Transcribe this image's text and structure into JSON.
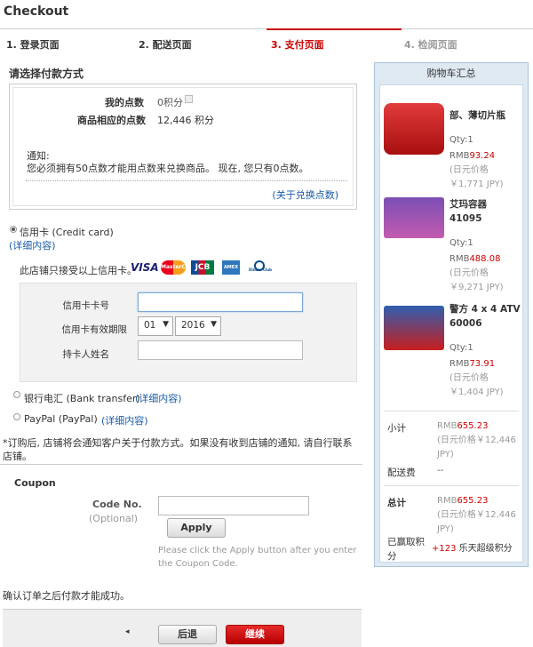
{
  "page": {
    "title": "Checkout"
  },
  "steps": [
    {
      "label": "1. 登录页面"
    },
    {
      "label": "2. 配送页面"
    },
    {
      "label": "3. 支付页面"
    },
    {
      "label": "4. 检阅页面"
    }
  ],
  "payment": {
    "section_title": "请选择付款方式",
    "points": {
      "my_points_label": "我的点数",
      "my_points_value": "0积分",
      "product_points_label": "商品相应的点数",
      "product_points_value": "12,446 积分",
      "notice_title": "通知:",
      "notice_text": "您必须拥有50点数才能用点数来兑换商品。 现在, 您只有0点数。",
      "about_link": "(关于兑换点数)"
    },
    "credit_card": {
      "label": "信用卡 (Credit card)",
      "details_link": "(详细内容)",
      "accepted_text": "此店铺只接受以上信用卡。",
      "logos": [
        "VISA",
        "MasterCard",
        "JCB",
        "AMEX",
        "Diners Club"
      ],
      "number_label": "信用卡卡号",
      "number_value": "",
      "expiry_label": "信用卡有效期限",
      "expiry_month": "01",
      "expiry_year": "2016",
      "holder_label": "持卡人姓名",
      "holder_value": ""
    },
    "bank": {
      "label": "银行电汇 (Bank transfer)",
      "details_link": "(详细内容)"
    },
    "paypal": {
      "label": "PayPal (PayPal)",
      "details_link": "(详细内容)"
    },
    "order_note": "*订购后, 店铺将会通知客户关于付款方式。如果没有收到店铺的通知, 请自行联系店铺。"
  },
  "coupon": {
    "title": "Coupon",
    "code_label": "Code No.",
    "optional": "(Optional)",
    "code_value": "",
    "apply_label": "Apply",
    "hint": "Please click the Apply button after you enter the Coupon Code."
  },
  "confirm_note": "确认订单之后付款才能成功。",
  "footer": {
    "arrow": "◂",
    "back_label": "后退",
    "next_label": "继续"
  },
  "cart": {
    "title": "购物车汇总",
    "items": [
      {
        "name": "部、薄切片瓶",
        "qty": "Qty:1",
        "price_prefix": "RMB",
        "price": "93.24",
        "yen": "(日元价格￥1,771 JPY)"
      },
      {
        "name": "艾玛容器 41095",
        "qty": "Qty:1",
        "price_prefix": "RMB",
        "price": "488.08",
        "yen": "(日元价格￥9,271 JPY)"
      },
      {
        "name": "警方 4 x 4 ATV 60006",
        "qty": "Qty:1",
        "price_prefix": "RMB",
        "price": "73.91",
        "yen": "(日元价格￥1,404 JPY)"
      }
    ],
    "subtotal_label": "小计",
    "subtotal_prefix": "RMB",
    "subtotal_value": "655.23",
    "subtotal_yen": "(日元价格￥12,446 JPY)",
    "shipping_label": "配送费",
    "shipping_value": "--",
    "total_label": "总计",
    "total_prefix": "RMB",
    "total_value": "655.23",
    "total_yen": "(日元价格￥12,446 JPY)",
    "earned_label": "已赢取积分",
    "earned_value": "+123",
    "earned_suffix": "乐天超级积分"
  },
  "colors": {
    "accent": "#cc0000",
    "link": "#1a5ca8",
    "cart_bg": "#dfe9f2"
  }
}
